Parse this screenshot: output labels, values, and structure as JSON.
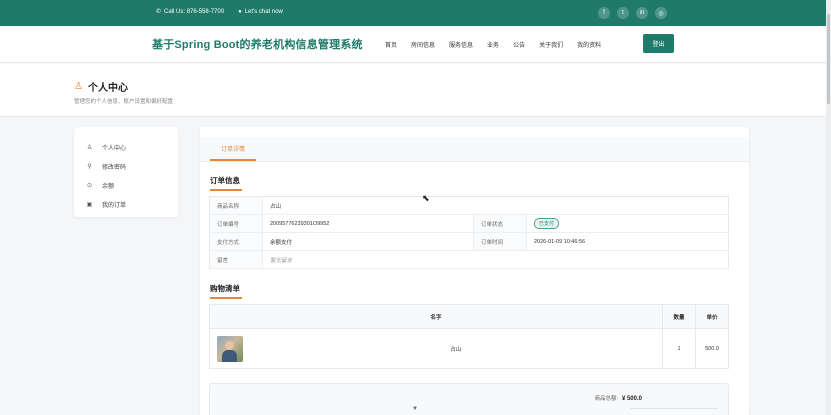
{
  "topbar": {
    "phone": "Call Us: 876-558-7700",
    "chat": "Let's chat now",
    "social_icons": [
      "facebook-icon",
      "twitter-icon",
      "linkedin-icon",
      "instagram-icon"
    ]
  },
  "nav": {
    "brand": "基于Spring Boot的养老机构信息管理系统",
    "menu": [
      "首页",
      "房间信息",
      "服务信息",
      "业务",
      "公告",
      "关于我们",
      "我的资料"
    ],
    "login": "登出"
  },
  "header": {
    "title": "个人中心",
    "subtitle": "管理您的个人信息、账户设置和偏好配置"
  },
  "sidebar": {
    "items": [
      {
        "label": "个人中心",
        "icon": "user-icon"
      },
      {
        "label": "修改密码",
        "icon": "key-icon"
      },
      {
        "label": "余额",
        "icon": "wallet-icon"
      },
      {
        "label": "我的订单",
        "icon": "order-icon"
      }
    ]
  },
  "tabs": [
    "订单详情"
  ],
  "order_info": {
    "section_title": "订单信息",
    "name_label": "商品名称",
    "name_value": "占山",
    "no_label": "订单编号",
    "no_value": "20095776239301O9952",
    "status_label": "订单状态",
    "status_value": "已支付",
    "pay_label": "支付方式",
    "pay_value": "余额支付",
    "time_label": "订单时间",
    "time_value": "2026-01-09 10:46:56",
    "remark_label": "留言",
    "remark_value": "暂无留言"
  },
  "shopping": {
    "section_title": "购物清单",
    "headers": {
      "name": "名字",
      "qty": "数量",
      "price": "单价"
    },
    "rows": [
      {
        "name": "占山",
        "qty": "1",
        "price": "500.0"
      }
    ]
  },
  "summary": {
    "label": "商品总额:",
    "value": "¥ 500.0"
  },
  "colors": {
    "brand": "#1f7a6a",
    "accent": "#e5863a"
  }
}
